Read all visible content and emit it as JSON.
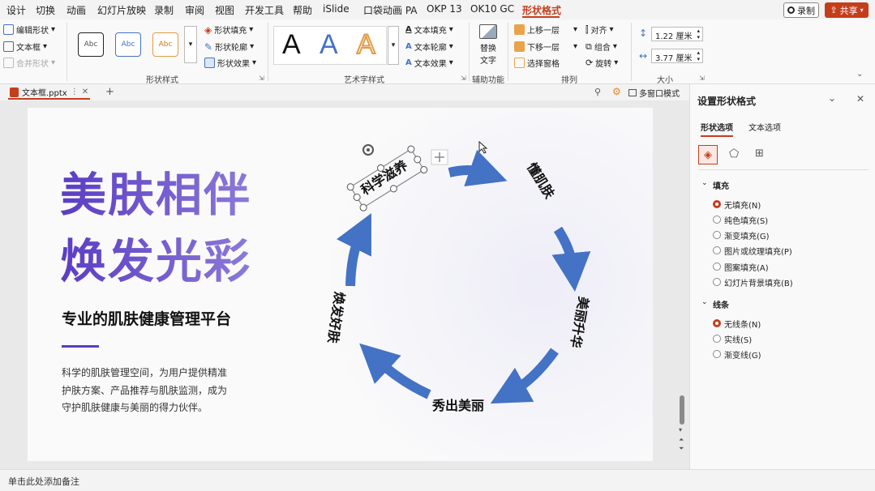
{
  "menu": {
    "items": [
      "设计",
      "切换",
      "动画",
      "幻灯片放映",
      "录制",
      "审阅",
      "视图",
      "开发工具",
      "帮助",
      "iSlide",
      "口袋动画 PA",
      "OKP 13",
      "OK10 GC",
      "形状格式"
    ],
    "record_label": "录制",
    "share_label": "共享"
  },
  "ribbon": {
    "insert": {
      "edit_shape": "编辑形状",
      "text_box": "文本框",
      "merge_shapes": "合并形状"
    },
    "shape_styles": {
      "sample": "Abc",
      "fill": "形状填充",
      "outline": "形状轮廓",
      "effects": "形状效果",
      "label": "形状样式"
    },
    "wordart": {
      "sample": "A",
      "text_fill": "文本填充",
      "text_outline": "文本轮廓",
      "text_effects": "文本效果",
      "label": "艺术字样式"
    },
    "accessibility": {
      "alt_text_1": "替换",
      "alt_text_2": "文字",
      "label": "辅助功能"
    },
    "arrange": {
      "bring_forward": "上移一层",
      "send_backward": "下移一层",
      "selection_pane": "选择窗格",
      "align": "对齐",
      "group": "组合",
      "rotate": "旋转",
      "label": "排列"
    },
    "size": {
      "height": "1.22 厘米",
      "width": "3.77 厘米",
      "label": "大小"
    }
  },
  "tabs": {
    "file_name": "文本框.pptx",
    "multi_window": "多窗口模式"
  },
  "slide": {
    "title_line1": "美肤相伴",
    "title_line2": "焕发光彩",
    "subtitle": "专业的肌肤健康管理平台",
    "desc": [
      "科学的肌肤管理空间，为用户提供精准",
      "护肤方案、产品推荐与肌肤监测，成为",
      "守护肌肤健康与美丽的得力伙伴。"
    ],
    "cycle": [
      "科学滋养",
      "懂肌肤",
      "美丽升华",
      "秀出美丽",
      "焕发好肤"
    ]
  },
  "panel": {
    "title": "设置形状格式",
    "tab_shape": "形状选项",
    "tab_text": "文本选项",
    "fill_header": "填充",
    "fill_options": [
      "无填充(N)",
      "纯色填充(S)",
      "渐变填充(G)",
      "图片或纹理填充(P)",
      "图案填充(A)",
      "幻灯片背景填充(B)"
    ],
    "line_header": "线条",
    "line_options": [
      "无线条(N)",
      "实线(S)",
      "渐变线(G)"
    ]
  },
  "status": {
    "notes": "单击此处添加备注"
  },
  "colors": {
    "accent": "#c43e1c",
    "brand_purple": "#5b3cc4",
    "cycle_blue": "#4472c4"
  }
}
